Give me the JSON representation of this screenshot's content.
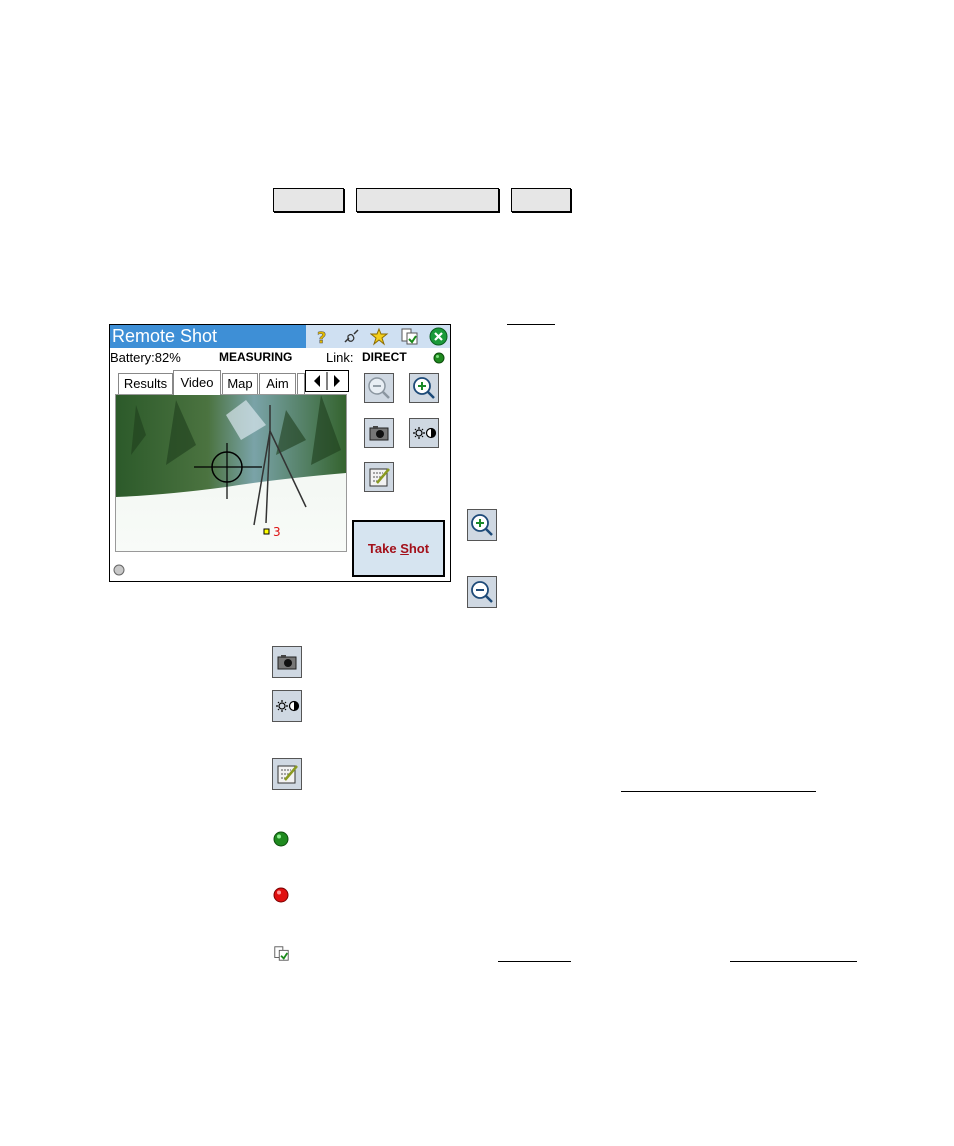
{
  "top_buttons": [
    {
      "label": ""
    },
    {
      "label": ""
    },
    {
      "label": ""
    }
  ],
  "device": {
    "title": "Remote Shot",
    "title_icons": [
      "help-icon",
      "connect-icon",
      "favorites-icon",
      "switch-to-icon",
      "close-icon"
    ],
    "battery": "Battery:82%",
    "state": "MEASURING",
    "link_label": "Link:",
    "link_value": "DIRECT",
    "link_status_color": "#1f8a1f",
    "tabs": [
      "Results",
      "Video",
      "Map",
      "Aim"
    ],
    "active_tab": "Video",
    "point_label": "3",
    "take_shot_pre": "Take ",
    "take_shot_ul": "S",
    "take_shot_post": "hot"
  },
  "legend_icons": [
    "zoom-in-icon",
    "zoom-out-icon",
    "snapshot-icon",
    "brightness-contrast-icon",
    "video-options-icon",
    "link-ok-icon",
    "link-error-icon",
    "switch-to-icon"
  ]
}
